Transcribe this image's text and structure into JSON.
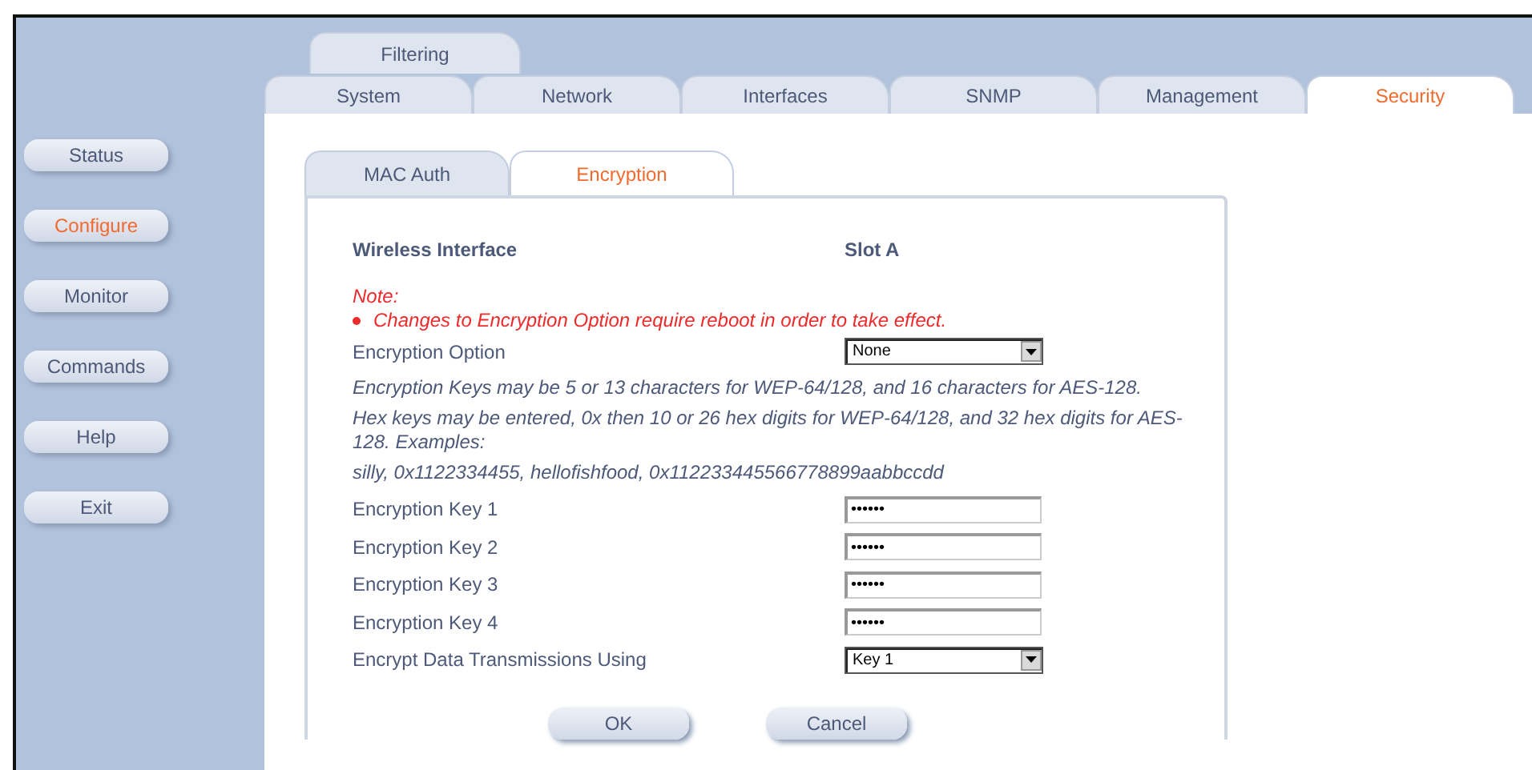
{
  "top_tabs": [
    {
      "label": "Filtering",
      "selected": false
    }
  ],
  "tabs": [
    {
      "label": "System",
      "selected": false
    },
    {
      "label": "Network",
      "selected": false
    },
    {
      "label": "Interfaces",
      "selected": false
    },
    {
      "label": "SNMP",
      "selected": false
    },
    {
      "label": "Management",
      "selected": false
    },
    {
      "label": "Security",
      "selected": true
    }
  ],
  "sidebar": {
    "items": [
      {
        "label": "Status",
        "selected": false
      },
      {
        "label": "Configure",
        "selected": true
      },
      {
        "label": "Monitor",
        "selected": false
      },
      {
        "label": "Commands",
        "selected": false
      },
      {
        "label": "Help",
        "selected": false
      },
      {
        "label": "Exit",
        "selected": false
      }
    ]
  },
  "sub_tabs": [
    {
      "label": "MAC Auth",
      "selected": false
    },
    {
      "label": "Encryption",
      "selected": true
    }
  ],
  "header": {
    "label": "Wireless Interface",
    "value": "Slot A"
  },
  "note": {
    "title": "Note:",
    "items": [
      "Changes to Encryption Option require reboot in order to take effect."
    ]
  },
  "fields": [
    {
      "kind": "select",
      "label": "Encryption Option",
      "value": "None"
    },
    {
      "kind": "hint",
      "text": "Encryption Keys may be 5 or 13 characters for WEP-64/128, and 16 characters for AES-128."
    },
    {
      "kind": "hint",
      "text": "Hex keys may be entered, 0x then 10 or 26 hex digits for WEP-64/128, and 32 hex digits for AES-128. Examples:"
    },
    {
      "kind": "hint",
      "text": "silly, 0x1122334455, hellofishfood, 0x112233445566778899aabbccdd"
    },
    {
      "kind": "password",
      "label": "Encryption Key 1",
      "value": "••••••"
    },
    {
      "kind": "password",
      "label": "Encryption Key 2",
      "value": "••••••"
    },
    {
      "kind": "password",
      "label": "Encryption Key 3",
      "value": "••••••"
    },
    {
      "kind": "password",
      "label": "Encryption Key 4",
      "value": "••••••"
    },
    {
      "kind": "select",
      "label": "Encrypt Data Transmissions Using",
      "value": "Key 1"
    }
  ],
  "buttons": [
    "OK",
    "Cancel"
  ]
}
